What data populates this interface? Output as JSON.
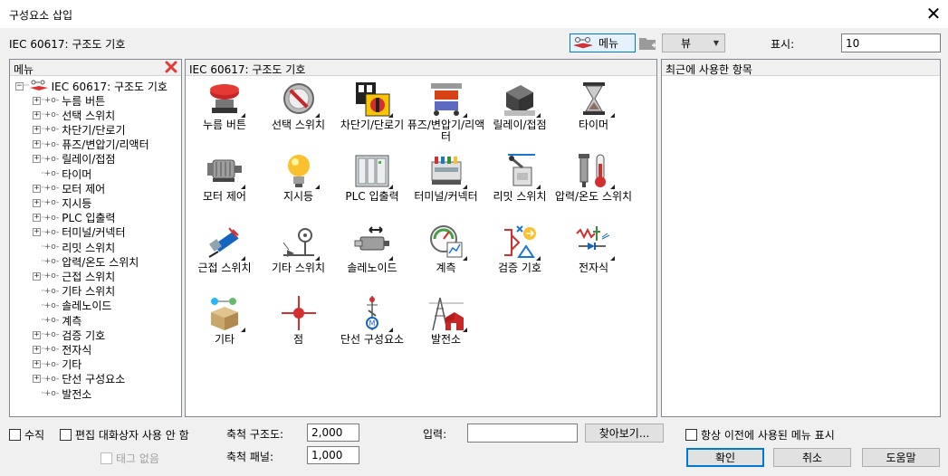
{
  "window": {
    "title": "구성요소 삽입",
    "close": "✕"
  },
  "toolbar": {
    "library_label": "IEC 60617: 구조도 기호",
    "menu_button": "메뉴",
    "view_button": "뷰",
    "display_label": "표시:",
    "display_value": "10"
  },
  "left_panel": {
    "title": "메뉴"
  },
  "tree": {
    "root": "IEC 60617: 구조도 기호",
    "items": [
      {
        "label": "누름 버튼",
        "expandable": true
      },
      {
        "label": "선택 스위치",
        "expandable": true
      },
      {
        "label": "차단기/단로기",
        "expandable": true
      },
      {
        "label": "퓨즈/변압기/리액터",
        "expandable": true
      },
      {
        "label": "릴레이/접점",
        "expandable": true
      },
      {
        "label": "타이머",
        "expandable": false
      },
      {
        "label": "모터 제어",
        "expandable": true
      },
      {
        "label": "지시등",
        "expandable": true
      },
      {
        "label": "PLC 입출력",
        "expandable": true
      },
      {
        "label": "터미널/커넥터",
        "expandable": true
      },
      {
        "label": "리밋 스위치",
        "expandable": false
      },
      {
        "label": "압력/온도 스위치",
        "expandable": false
      },
      {
        "label": "근접 스위치",
        "expandable": true
      },
      {
        "label": "기타 스위치",
        "expandable": false
      },
      {
        "label": "솔레노이드",
        "expandable": false
      },
      {
        "label": "계측",
        "expandable": false
      },
      {
        "label": "검증 기호",
        "expandable": true
      },
      {
        "label": "전자식",
        "expandable": true
      },
      {
        "label": "기타",
        "expandable": true
      },
      {
        "label": "단선 구성요소",
        "expandable": true
      },
      {
        "label": "발전소",
        "expandable": false
      }
    ]
  },
  "center_panel": {
    "title": "IEC 60617: 구조도 기호"
  },
  "icons": [
    {
      "label": "누름 버튼",
      "icon": "push-button-icon"
    },
    {
      "label": "선택 스위치",
      "icon": "selector-switch-icon"
    },
    {
      "label": "차단기/단로기",
      "icon": "breaker-icon"
    },
    {
      "label": "퓨즈/변압기/리액터",
      "icon": "fuse-transformer-icon"
    },
    {
      "label": "릴레이/접점",
      "icon": "relay-icon"
    },
    {
      "label": "타이머",
      "icon": "timer-icon"
    },
    {
      "label": "모터 제어",
      "icon": "motor-icon"
    },
    {
      "label": "지시등",
      "icon": "pilot-light-icon"
    },
    {
      "label": "PLC 입출력",
      "icon": "plc-icon"
    },
    {
      "label": "터미널/커넥터",
      "icon": "terminal-icon"
    },
    {
      "label": "리밋 스위치",
      "icon": "limit-switch-icon"
    },
    {
      "label": "압력/온도 스위치",
      "icon": "pressure-temp-icon"
    },
    {
      "label": "근접 스위치",
      "icon": "proximity-icon"
    },
    {
      "label": "기타 스위치",
      "icon": "other-switch-icon"
    },
    {
      "label": "솔레노이드",
      "icon": "solenoid-icon"
    },
    {
      "label": "계측",
      "icon": "instrument-icon"
    },
    {
      "label": "검증 기호",
      "icon": "verification-icon"
    },
    {
      "label": "전자식",
      "icon": "electronic-icon"
    },
    {
      "label": "기타",
      "icon": "misc-icon"
    },
    {
      "label": "점",
      "icon": "dot-icon"
    },
    {
      "label": "단선 구성요소",
      "icon": "one-line-icon"
    },
    {
      "label": "발전소",
      "icon": "power-plant-icon"
    }
  ],
  "right_panel": {
    "title": "최근에 사용한 항목"
  },
  "bottom": {
    "vertical": "수직",
    "no_edit_dialog": "편집 대화상자 사용 안 함",
    "no_tag": "태그 없음",
    "scale_schematic_label": "축척 구조도:",
    "scale_schematic_value": "2,000",
    "scale_panel_label": "축척 패널:",
    "scale_panel_value": "1,000",
    "input_label": "입력:",
    "input_value": "",
    "browse": "찾아보기...",
    "always_previous_menu": "항상 이전에 사용된 메뉴 표시",
    "ok": "확인",
    "cancel": "취소",
    "help": "도움말"
  },
  "colors": {
    "red_x": "#e53935",
    "accent": "#0078d7"
  }
}
